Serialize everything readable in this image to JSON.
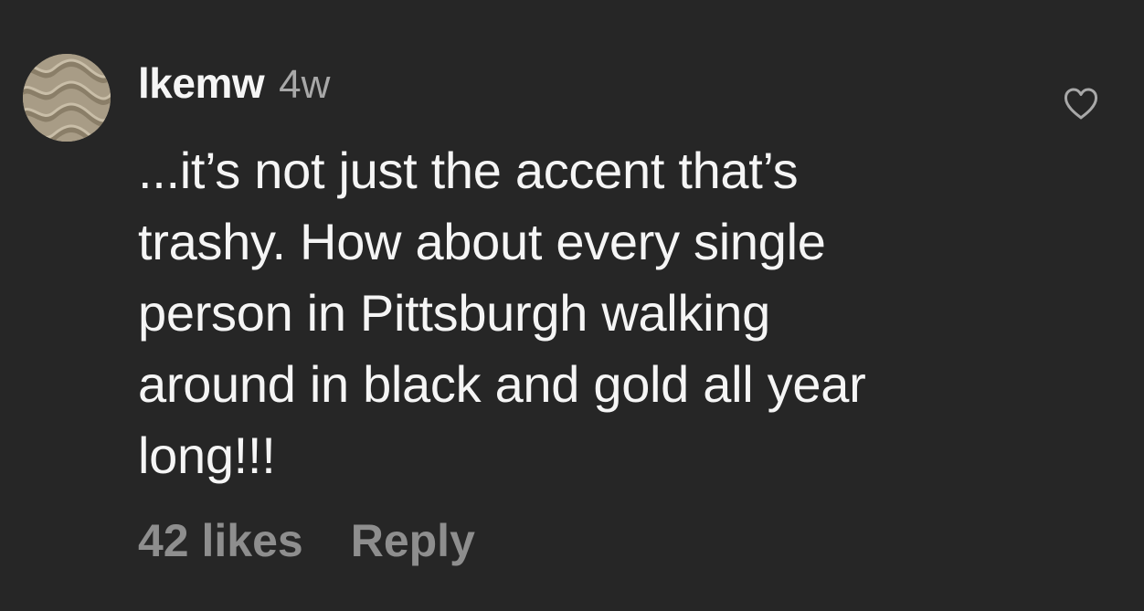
{
  "comment": {
    "username": "lkemw",
    "timestamp": "4w",
    "text": "...it’s not just the accent that’s\ntrashy.  How about every single\nperson in Pittsburgh walking\naround in black and gold all year\nlong!!!",
    "likes_label": "42 likes",
    "reply_label": "Reply",
    "like_icon": "heart-outline-icon",
    "avatar_icon": "knit-pattern-avatar"
  },
  "colors": {
    "background": "#262626",
    "primary_text": "#f5f5f5",
    "secondary_text": "#8e8e8e",
    "timestamp_text": "#a8a8a8"
  }
}
